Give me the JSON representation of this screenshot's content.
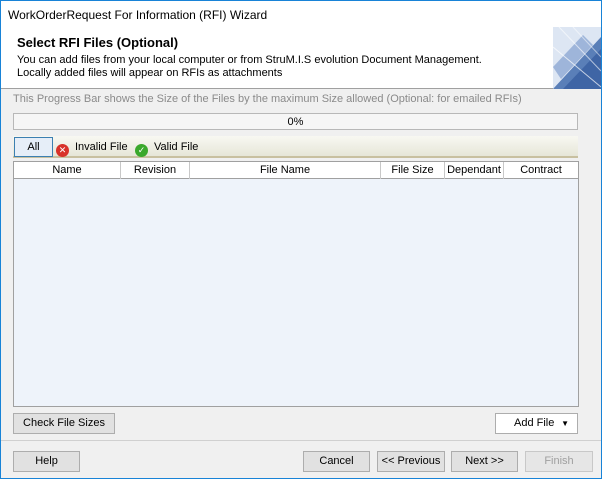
{
  "window": {
    "title": "WorkOrderRequest For Information (RFI) Wizard"
  },
  "header": {
    "title": "Select RFI Files (Optional)",
    "description": "You can add files from your local computer or from StruM.I.S evolution Document Management. Locally added files will appear on RFIs as attachments"
  },
  "progress": {
    "caption": "This Progress Bar shows the Size of the Files  by the maximum Size allowed (Optional: for emailed RFIs)",
    "label": "0%",
    "value_percent": 0
  },
  "filters": {
    "all_label": "All",
    "invalid_label": "Invalid File",
    "valid_label": "Valid File",
    "invalid_icon": "error-x-icon",
    "valid_icon": "checkmark-icon"
  },
  "grid": {
    "columns": [
      "Name",
      "Revision",
      "File Name",
      "File Size",
      "Dependant",
      "Contract"
    ],
    "rows": []
  },
  "actions": {
    "check_sizes": "Check File Sizes",
    "add_file": "Add File",
    "help": "Help",
    "cancel": "Cancel",
    "previous": "<< Previous",
    "next": "Next >>",
    "finish": "Finish"
  },
  "colors": {
    "accent": "#1883d7",
    "invalid": "#d8322a",
    "valid": "#3aa82c"
  }
}
